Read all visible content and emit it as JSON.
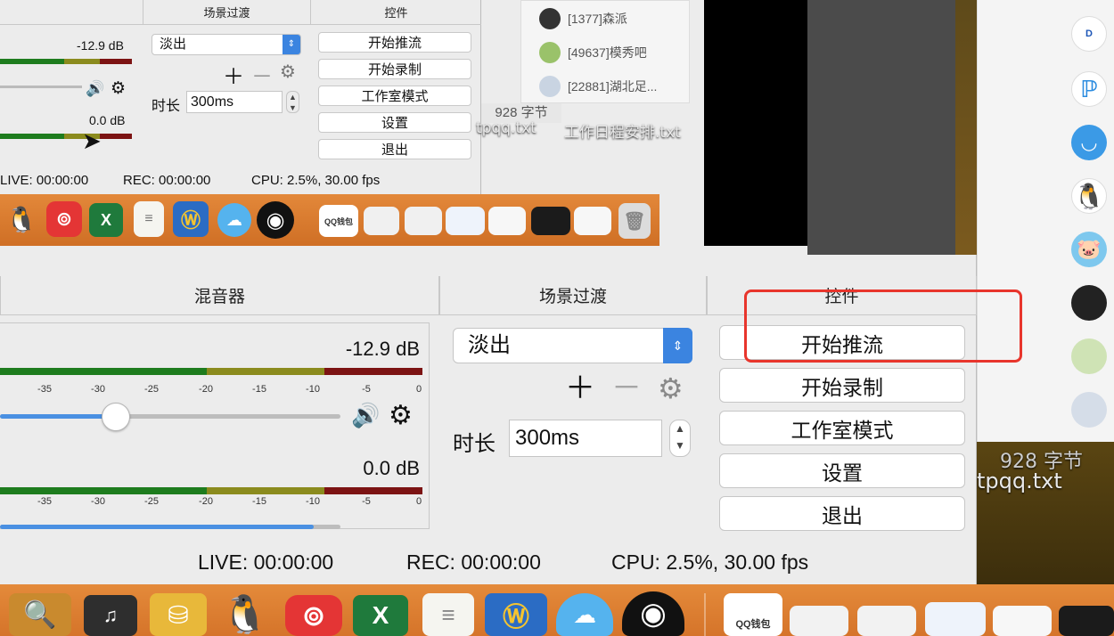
{
  "inner": {
    "scene_transition_label": "场景过渡",
    "controls_label": "控件",
    "db_top": "-12.9 dB",
    "db_bottom": "0.0 dB",
    "transition_value": "淡出",
    "duration_label": "时长",
    "duration_value": "300ms",
    "buttons": [
      "开始推流",
      "开始录制",
      "工作室模式",
      "设置",
      "退出"
    ],
    "status": {
      "live": "LIVE: 00:00:00",
      "rec": "REC: 00:00:00",
      "cpu": "CPU: 2.5%, 30.00 fps"
    },
    "chats": [
      "[1377]森派",
      "[49637]模秀吧",
      "[22881]湖北足..."
    ],
    "file_size": "928 字节",
    "files": [
      "tpqq.txt",
      "工作日程安排.txt"
    ]
  },
  "main": {
    "mixer_label": "混音器",
    "scene_transition_label": "场景过渡",
    "controls_label": "控件",
    "db_top": "-12.9 dB",
    "db_bottom": "0.0 dB",
    "tick_labels": [
      "-35",
      "-30",
      "-25",
      "-20",
      "-15",
      "-10",
      "-5",
      "0"
    ],
    "transition_value": "淡出",
    "duration_label": "时长",
    "duration_value": "300ms",
    "buttons": [
      "开始推流",
      "开始录制",
      "工作室模式",
      "设置",
      "退出"
    ],
    "status": {
      "live": "LIVE: 00:00:00",
      "rec": "REC: 00:00:00",
      "cpu": "CPU: 2.5%, 30.00 fps"
    }
  },
  "desktop": {
    "file_size": "928 字节",
    "file_name": "tpqq.txt",
    "dock_qq_wallet": "QQ钱包"
  },
  "colors": {
    "highlight": "#e8352c",
    "accent_blue": "#4a90e2",
    "meter_green": "#1e7c1e",
    "meter_yellow": "#8b8b1e",
    "meter_red": "#7c1313"
  }
}
